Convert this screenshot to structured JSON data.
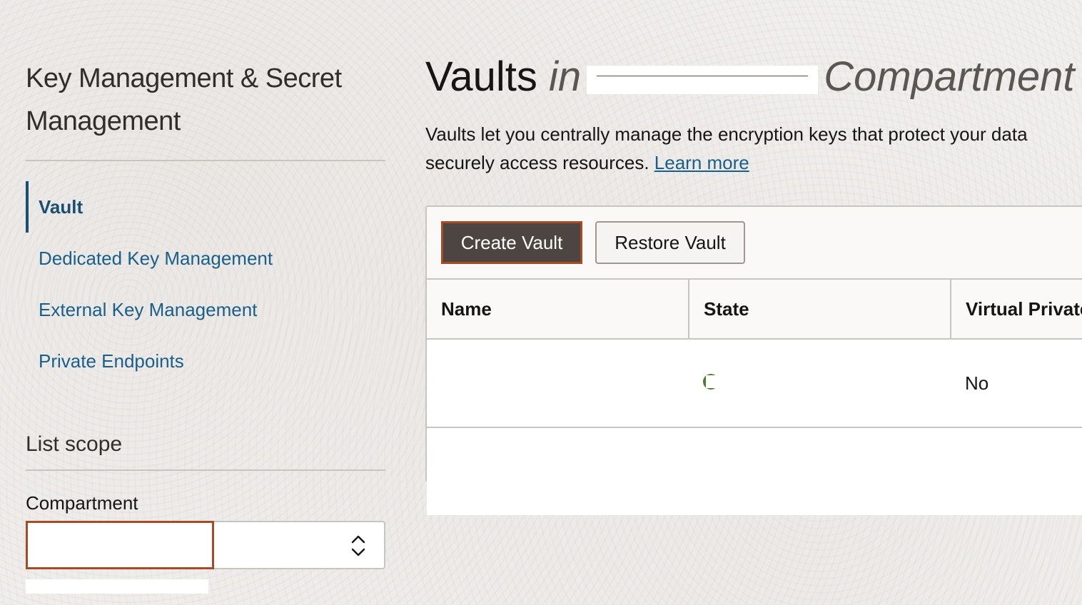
{
  "sidebar": {
    "title": "Key Management & Secret Management",
    "items": [
      {
        "label": "Vault",
        "active": true
      },
      {
        "label": "Dedicated Key Management",
        "active": false
      },
      {
        "label": "External Key Management",
        "active": false
      },
      {
        "label": "Private Endpoints",
        "active": false
      }
    ],
    "list_scope": {
      "title": "List scope",
      "compartment_label": "Compartment"
    }
  },
  "main": {
    "title_prefix": "Vaults",
    "title_in": "in",
    "title_suffix": "Compartment",
    "description": "Vaults let you centrally manage the encryption keys that protect your data",
    "description_line2": "securely access resources.",
    "learn_more": "Learn more",
    "buttons": {
      "create": "Create Vault",
      "restore": "Restore Vault"
    },
    "table": {
      "columns": [
        "Name",
        "State",
        "Virtual Private"
      ],
      "rows": [
        {
          "virtual_private": "No"
        }
      ]
    }
  },
  "colors": {
    "accent_link": "#1a5f8a",
    "highlight_border": "#a74b27",
    "primary_button": "#4d4541",
    "status_active": "#4f7c2a"
  }
}
